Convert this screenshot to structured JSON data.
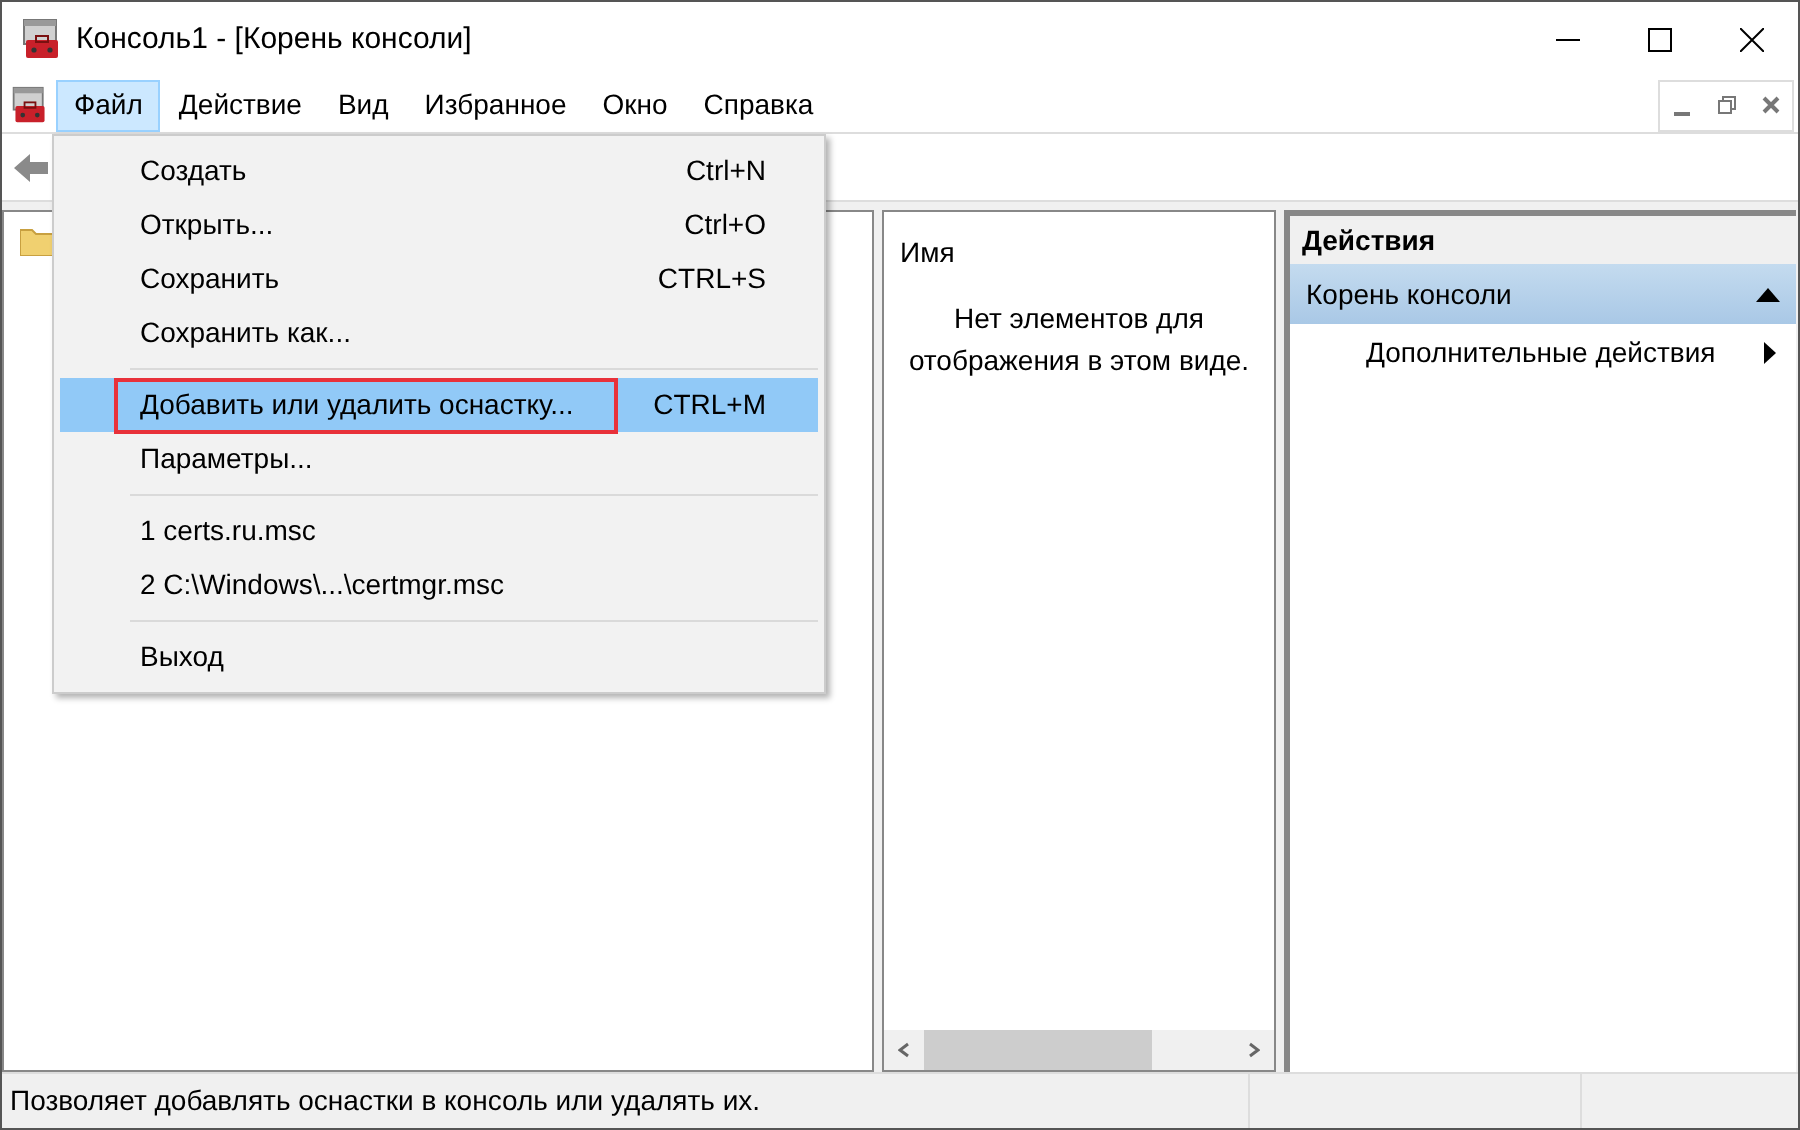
{
  "window": {
    "title": "Консоль1 - [Корень консоли]"
  },
  "menu_bar": [
    {
      "label": "Файл",
      "selected": true
    },
    {
      "label": "Действие",
      "selected": false
    },
    {
      "label": "Вид",
      "selected": false
    },
    {
      "label": "Избранное",
      "selected": false
    },
    {
      "label": "Окно",
      "selected": false
    },
    {
      "label": "Справка",
      "selected": false
    }
  ],
  "file_menu": [
    {
      "kind": "item",
      "label": "Создать",
      "shortcut": "Ctrl+N",
      "selected": false,
      "outlined": false
    },
    {
      "kind": "item",
      "label": "Открыть...",
      "shortcut": "Ctrl+O",
      "selected": false,
      "outlined": false
    },
    {
      "kind": "item",
      "label": "Сохранить",
      "shortcut": "CTRL+S",
      "selected": false,
      "outlined": false
    },
    {
      "kind": "item",
      "label": "Сохранить как...",
      "selected": false,
      "outlined": false
    },
    {
      "kind": "separator"
    },
    {
      "kind": "item",
      "label": "Добавить или удалить оснастку...",
      "shortcut": "CTRL+M",
      "selected": true,
      "outlined": true
    },
    {
      "kind": "item",
      "label": "Параметры...",
      "selected": false,
      "outlined": false
    },
    {
      "kind": "separator"
    },
    {
      "kind": "item",
      "label": "1 certs.ru.msc",
      "selected": false,
      "outlined": false
    },
    {
      "kind": "item",
      "label": "2 C:\\Windows\\...\\certmgr.msc",
      "selected": false,
      "outlined": false
    },
    {
      "kind": "separator"
    },
    {
      "kind": "item",
      "label": "Выход",
      "selected": false,
      "outlined": false
    }
  ],
  "list_pane": {
    "column": "Имя",
    "empty_message": "Нет элементов для отображения в этом виде."
  },
  "actions_pane": {
    "title": "Действия",
    "section": "Корень консоли",
    "items": [
      "Дополнительные действия"
    ]
  },
  "status_bar": "Позволяет добавлять оснастки в консоль или удалять их."
}
